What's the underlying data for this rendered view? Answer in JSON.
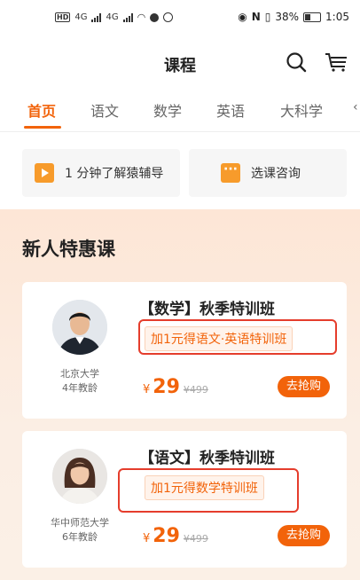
{
  "status_bar": {
    "hd": "HD",
    "net1": "4G",
    "net2": "4G",
    "battery_pct": "38%",
    "time": "1:05"
  },
  "header": {
    "title": "课程",
    "search_icon": "search-icon",
    "cart_icon": "cart-icon"
  },
  "tabs": [
    {
      "label": "首页",
      "active": true
    },
    {
      "label": "语文"
    },
    {
      "label": "数学"
    },
    {
      "label": "英语"
    },
    {
      "label": "大科学"
    }
  ],
  "quick_links": [
    {
      "label": "1 分钟了解猿辅导",
      "icon": "play-icon"
    },
    {
      "label": "选课咨询",
      "icon": "chat-icon"
    }
  ],
  "section_title": "新人特惠课",
  "courses": [
    {
      "title": "【数学】秋季特训班",
      "tag": "加1元得语文·英语特训班",
      "school": "北京大学",
      "experience": "4年教龄",
      "currency": "¥",
      "price": "29",
      "original_price": "¥499",
      "button": "去抢购"
    },
    {
      "title": "【语文】秋季特训班",
      "tag": "加1元得数学特训班",
      "school": "华中师范大学",
      "experience": "6年教龄",
      "currency": "¥",
      "price": "29",
      "original_price": "¥499",
      "button": "去抢购"
    }
  ],
  "colors": {
    "accent": "#f2630a",
    "highlight": "#e53d2c"
  }
}
